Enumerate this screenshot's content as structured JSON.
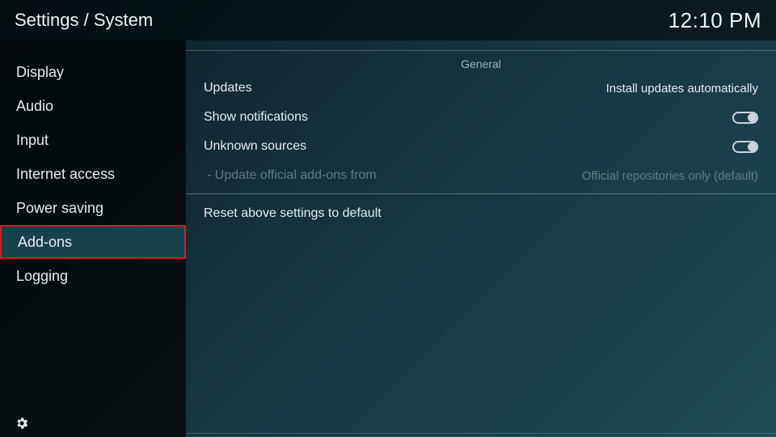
{
  "header": {
    "title": "Settings / System",
    "clock": "12:10 PM"
  },
  "sidebar": {
    "items": [
      {
        "label": "Display"
      },
      {
        "label": "Audio"
      },
      {
        "label": "Input"
      },
      {
        "label": "Internet access"
      },
      {
        "label": "Power saving"
      },
      {
        "label": "Add-ons"
      },
      {
        "label": "Logging"
      }
    ],
    "selected_index": 5
  },
  "main": {
    "section_title": "General",
    "rows": {
      "updates": {
        "label": "Updates",
        "value": "Install updates automatically"
      },
      "show_notifications": {
        "label": "Show notifications",
        "toggle": false
      },
      "unknown_sources": {
        "label": "Unknown sources",
        "toggle": false
      },
      "update_official": {
        "label": "- Update official add-ons from",
        "value": "Official repositories only (default)"
      },
      "reset": {
        "label": "Reset above settings to default"
      }
    }
  }
}
